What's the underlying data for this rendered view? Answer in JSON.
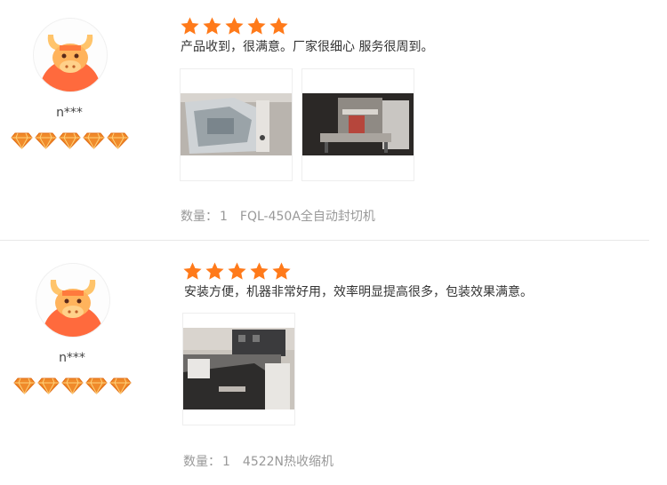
{
  "reviews": [
    {
      "username": "n***",
      "rating": 5,
      "level_gems": 5,
      "comment": "产品收到，很满意。厂家很细心 服务很周到。",
      "photo_count": 2,
      "quantity_label": "数量：",
      "quantity": "1",
      "product": "FQL-450A全自动封切机"
    },
    {
      "username": "n***",
      "rating": 5,
      "level_gems": 5,
      "comment": "安装方便，机器非常好用，效率明显提高很多，包装效果满意。",
      "photo_count": 1,
      "quantity_label": "数量：",
      "quantity": "1",
      "product": "4522N热收缩机"
    }
  ],
  "colors": {
    "star": "#ff7a1a",
    "gem": "#f08a2a",
    "avatar_bg": "#ff6a3d",
    "meta_text": "#999999"
  },
  "icons": {
    "avatar": "bull-avatar-icon",
    "star": "star-icon",
    "gem": "diamond-icon"
  }
}
